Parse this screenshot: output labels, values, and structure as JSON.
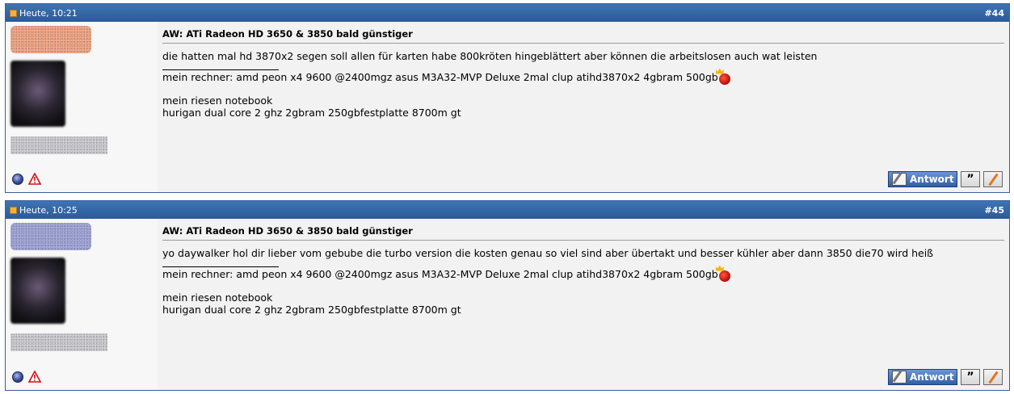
{
  "posts": [
    {
      "date": "Heute, 10:21",
      "number": "#44",
      "title": "AW: ATi Radeon HD 3650 & 3850 bald günstiger",
      "message": "die hatten mal hd 3870x2 segen soll allen für karten habe 800kröten hingeblättert aber können die arbeitslosen auch wat leisten",
      "signature": {
        "line1": "mein rechner: amd peon x4 9600 @2400mgz asus M3A32-MVP Deluxe 2mal clup atihd3870x2 4gbram 500gb",
        "line2": "mein riesen notebook",
        "line3": "hurigan dual core 2 ghz 2gbram 250gbfestplatte 8700m gt"
      },
      "reply_label": "Antwort"
    },
    {
      "date": "Heute, 10:25",
      "number": "#45",
      "title": "AW: ATi Radeon HD 3650 & 3850 bald günstiger",
      "message": "yo daywalker hol dir lieber vom gebube die turbo version die kosten genau so viel sind aber übertakt und besser kühler aber dann 3850 die70 wird heiß",
      "signature": {
        "line1": "mein rechner: amd peon x4 9600 @2400mgz asus M3A32-MVP Deluxe 2mal clup atihd3870x2 4gbram 500gb",
        "line2": "mein riesen notebook",
        "line3": "hurigan dual core 2 ghz 2gbram 250gbfestplatte 8700m gt"
      },
      "reply_label": "Antwort"
    }
  ],
  "colors": {
    "header_blue": "#2b5a97",
    "border_blue": "#3a5f9a",
    "post_background": "#f2f2f2"
  },
  "icons": [
    "document-icon",
    "online-status-icon",
    "report-warning-icon",
    "smiley-icon",
    "reply-pen-icon",
    "quote-icon",
    "edit-icon"
  ]
}
